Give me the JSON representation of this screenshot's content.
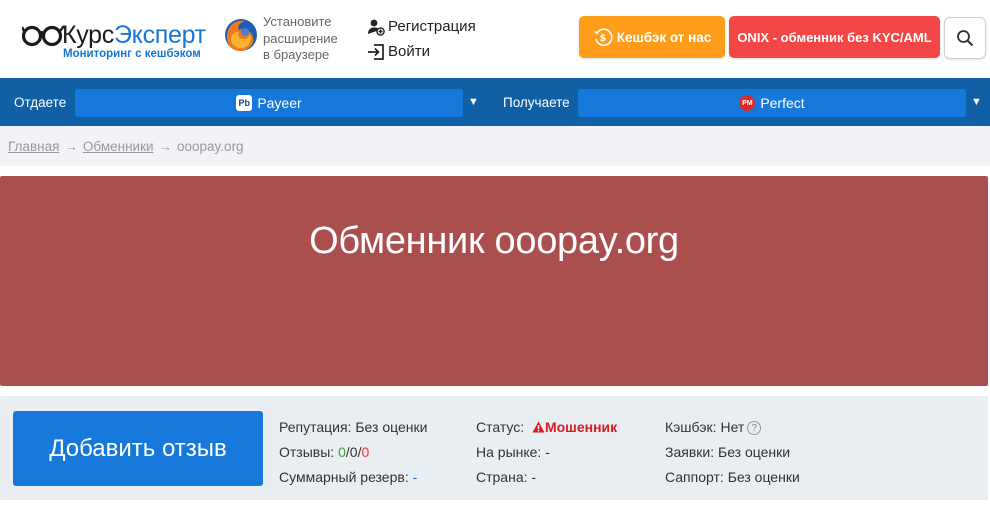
{
  "header": {
    "logo_title_part1": "Курс",
    "logo_title_part2": "Эксперт",
    "logo_subtitle": "Мониторинг с кешбэком",
    "extension_lines": [
      "Установите",
      "расширение",
      "в браузере"
    ],
    "register_label": "Регистрация",
    "login_label": "Войти",
    "cashback_button": "Кешбэк от нас",
    "onix_button": "ONIX - обменник без KYC/AML"
  },
  "exchange_bar": {
    "give_label": "Отдаете",
    "give_currency": "Payeer",
    "give_icon_text": "Pb",
    "get_label": "Получаете",
    "get_currency": "Perfect",
    "get_icon_text": "PM"
  },
  "breadcrumb": {
    "home": "Главная",
    "exchangers": "Обменники",
    "current": "ooopay.org",
    "separator": "→"
  },
  "hero": {
    "title": "Обменник ooopay.org"
  },
  "info": {
    "add_review_button": "Добавить отзыв",
    "reputation_label": "Репутация:",
    "reputation_value": "Без оценки",
    "reviews_label": "Отзывы:",
    "reviews_positive": "0",
    "reviews_neutral": "0",
    "reviews_negative": "0",
    "reserve_label": "Суммарный резерв:",
    "reserve_value": "-",
    "status_label": "Статус:",
    "status_value": "Мошенник",
    "market_label": "На рынке:",
    "market_value": "-",
    "country_label": "Страна:",
    "country_value": "-",
    "cashback_label": "Кэшбэк:",
    "cashback_value": "Нет",
    "requests_label": "Заявки:",
    "requests_value": "Без оценки",
    "support_label": "Саппорт:",
    "support_value": "Без оценки"
  },
  "colors": {
    "hero_bg": "#ab4e4e",
    "primary_blue": "#1778dc",
    "nav_blue": "#1160a6",
    "cashback_orange": "#ff9c19",
    "onix_red": "#f34747"
  }
}
